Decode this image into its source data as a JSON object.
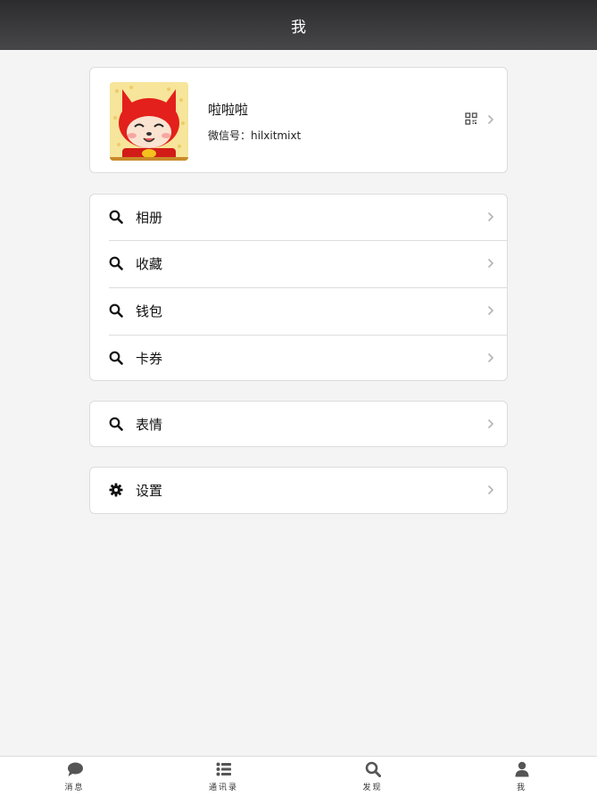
{
  "header": {
    "title": "我"
  },
  "profile": {
    "name": "啦啦啦",
    "wechat_id": "微信号：hilxitmixt"
  },
  "menu_group_1": [
    {
      "label": "相册",
      "icon": "search-icon"
    },
    {
      "label": "收藏",
      "icon": "search-icon"
    },
    {
      "label": "钱包",
      "icon": "search-icon"
    },
    {
      "label": "卡券",
      "icon": "search-icon"
    }
  ],
  "menu_group_2": [
    {
      "label": "表情",
      "icon": "search-icon"
    }
  ],
  "menu_group_3": [
    {
      "label": "设置",
      "icon": "gear-icon"
    }
  ],
  "tabbar": [
    {
      "label": "消息",
      "icon": "chat-bubble-icon"
    },
    {
      "label": "通讯录",
      "icon": "list-icon"
    },
    {
      "label": "发现",
      "icon": "search-icon"
    },
    {
      "label": "我",
      "icon": "user-icon"
    }
  ],
  "colors": {
    "header_top": "#2c2c2e",
    "header_bottom": "#47474a",
    "background": "#f4f4f4",
    "card": "#ffffff",
    "border": "#dcdcdc",
    "chevron": "#b4b4b4",
    "tab_icon": "#555555"
  }
}
